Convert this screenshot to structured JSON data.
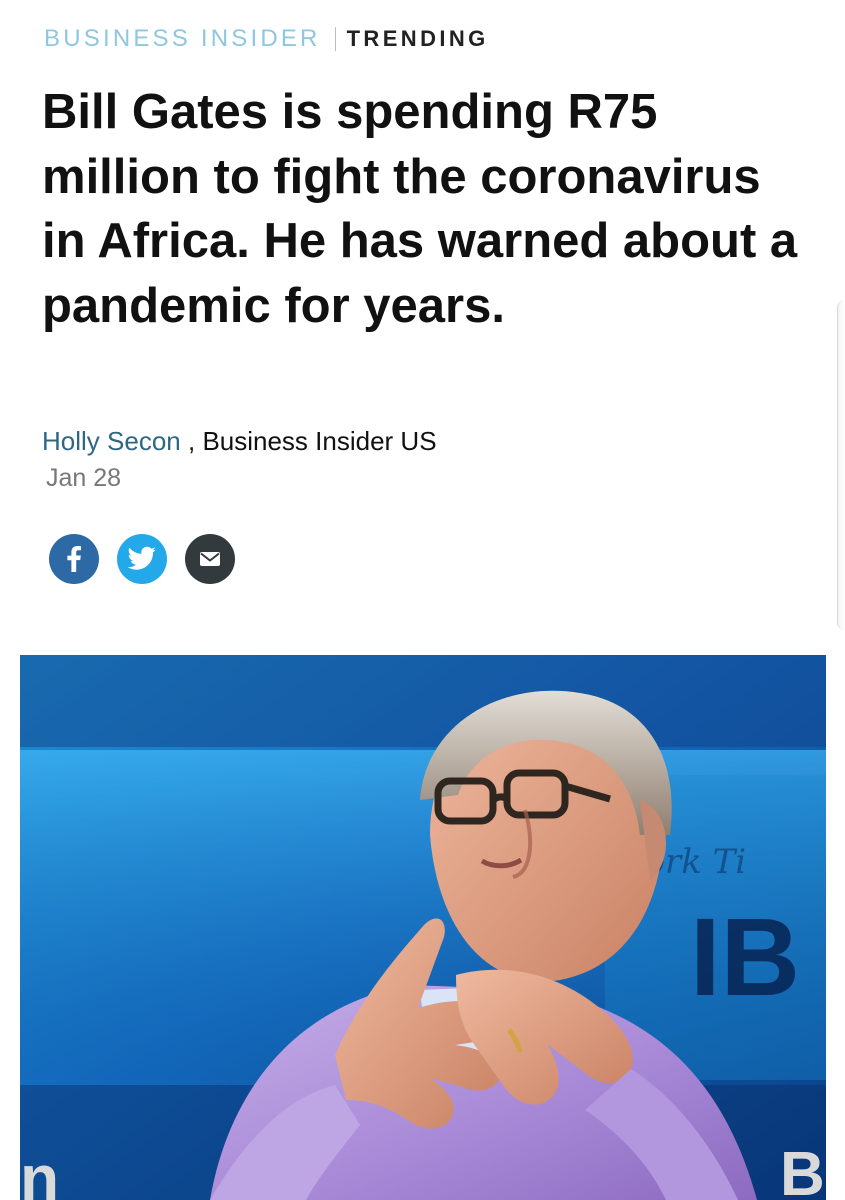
{
  "header": {
    "brand": "BUSINESS INSIDER",
    "section": "TRENDING"
  },
  "article": {
    "headline": "Bill Gates is spending R75 million to fight the coronavirus in Africa. He has warned about a pandemic for years.",
    "author": "Holly Secon",
    "byline_separator": ",",
    "publication": "Business Insider US",
    "date": "Jan 28"
  },
  "share": {
    "facebook_icon": "facebook-icon",
    "twitter_icon": "twitter-icon",
    "email_icon": "email-icon"
  },
  "hero_image": {
    "backdrop_text_1": "York Ti",
    "backdrop_text_2": "IB",
    "backdrop_text_3": "B",
    "backdrop_text_4": "n"
  },
  "colors": {
    "brand_blue": "#8ec7e1",
    "author_blue": "#2c6886",
    "facebook_blue": "#2d69a5",
    "twitter_blue": "#23a9ea",
    "email_gray": "#333a3e"
  }
}
